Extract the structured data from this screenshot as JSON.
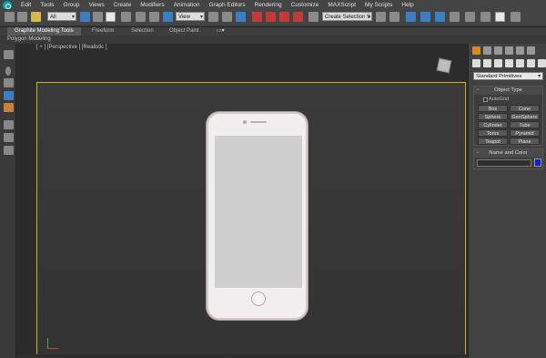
{
  "menu": {
    "items": [
      "Edit",
      "Tools",
      "Group",
      "Views",
      "Create",
      "Modifiers",
      "Animation",
      "Graph Editors",
      "Rendering",
      "Customize",
      "MAXScript",
      "My Scripts",
      "Help"
    ]
  },
  "toolbar": {
    "selection_filter": "All",
    "reference_coord": "View",
    "named_selection": "Create Selection S"
  },
  "ribbon": {
    "tabs": [
      "Graphite Modeling Tools",
      "Freeform",
      "Selection",
      "Object Paint"
    ],
    "active_tab": "Graphite Modeling Tools",
    "sub_panel": "Polygon Modeling"
  },
  "viewport": {
    "label": "[ + ] [Perspective ] [Realistic ]"
  },
  "command_panel": {
    "category_dropdown": "Standard Primitives",
    "object_type_title": "Object Type",
    "autogrid_label": "AutoGrid",
    "object_buttons": [
      "Box",
      "Cone",
      "Sphere",
      "GeoSphere",
      "Cylinder",
      "Tube",
      "Torus",
      "Pyramid",
      "Teapot",
      "Plane"
    ],
    "name_color_title": "Name and Color",
    "object_color": "#1022c8"
  },
  "colors": {
    "viewport_border": "#c8b429",
    "active_tab_accent": "#d48a1c"
  }
}
